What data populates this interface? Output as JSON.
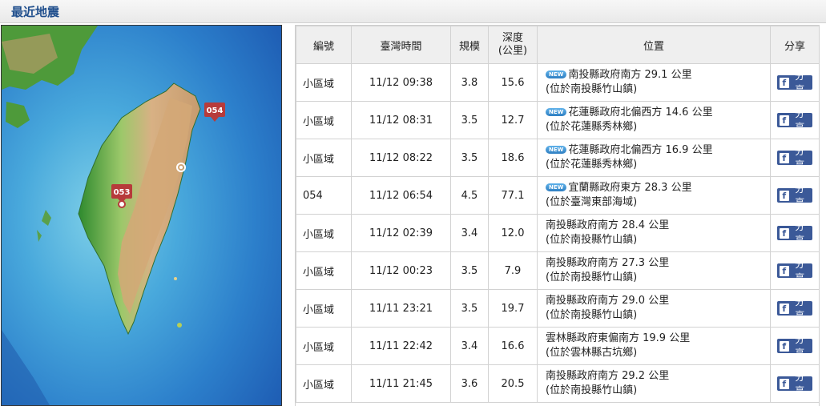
{
  "header": {
    "title": "最近地震"
  },
  "map": {
    "markers": [
      {
        "label": "054"
      },
      {
        "label": "053"
      }
    ]
  },
  "table": {
    "columns": [
      "編號",
      "臺灣時間",
      "規模",
      "深度\n(公里)",
      "位置",
      "分享"
    ],
    "share_label": "分享",
    "new_badge": "NEW",
    "rows": [
      {
        "id": "小區域",
        "time": "11/12 09:38",
        "mag": "3.8",
        "depth": "15.6",
        "loc1": "南投縣政府南方 29.1 公里",
        "loc2": "(位於南投縣竹山鎮)",
        "new": true
      },
      {
        "id": "小區域",
        "time": "11/12 08:31",
        "mag": "3.5",
        "depth": "12.7",
        "loc1": "花蓮縣政府北偏西方 14.6 公里",
        "loc2": "(位於花蓮縣秀林鄉)",
        "new": true
      },
      {
        "id": "小區域",
        "time": "11/12 08:22",
        "mag": "3.5",
        "depth": "18.6",
        "loc1": "花蓮縣政府北偏西方 16.9 公里",
        "loc2": "(位於花蓮縣秀林鄉)",
        "new": true
      },
      {
        "id": "054",
        "time": "11/12 06:54",
        "mag": "4.5",
        "depth": "77.1",
        "loc1": "宜蘭縣政府東方 28.3 公里",
        "loc2": "(位於臺灣東部海域)",
        "new": true
      },
      {
        "id": "小區域",
        "time": "11/12 02:39",
        "mag": "3.4",
        "depth": "12.0",
        "loc1": "南投縣政府南方 28.4 公里",
        "loc2": "(位於南投縣竹山鎮)",
        "new": false
      },
      {
        "id": "小區域",
        "time": "11/12 00:23",
        "mag": "3.5",
        "depth": "7.9",
        "loc1": "南投縣政府南方 27.3 公里",
        "loc2": "(位於南投縣竹山鎮)",
        "new": false
      },
      {
        "id": "小區域",
        "time": "11/11 23:21",
        "mag": "3.5",
        "depth": "19.7",
        "loc1": "南投縣政府南方 29.0 公里",
        "loc2": "(位於南投縣竹山鎮)",
        "new": false
      },
      {
        "id": "小區域",
        "time": "11/11 22:42",
        "mag": "3.4",
        "depth": "16.6",
        "loc1": "雲林縣政府東偏南方 19.9 公里",
        "loc2": "(位於雲林縣古坑鄉)",
        "new": false
      },
      {
        "id": "小區域",
        "time": "11/11 21:45",
        "mag": "3.6",
        "depth": "20.5",
        "loc1": "南投縣政府南方 29.2 公里",
        "loc2": "(位於南投縣竹山鎮)",
        "new": false
      }
    ]
  }
}
